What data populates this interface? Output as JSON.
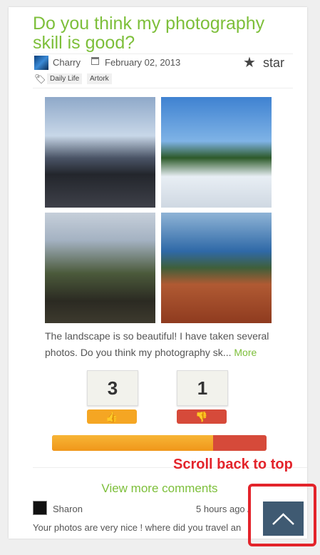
{
  "post": {
    "title": "Do you think my photography skill is good?",
    "author": "Charry",
    "date": "February 02, 2013",
    "rating_label": "star",
    "tags": [
      "Daily Life",
      "Artork"
    ],
    "excerpt": "The landscape is so beautiful! I have taken several photos. Do you think my photography sk...",
    "more_label": "More"
  },
  "votes": {
    "up": "3",
    "down": "1",
    "up_fraction": 0.75
  },
  "comments": {
    "view_more_label": "View more comments",
    "first": {
      "author": "Sharon",
      "time": "5 hours ago /",
      "text": "Your photos are very nice ! where did you travel an"
    }
  },
  "annotation": {
    "label": "Scroll back to top",
    "color": "#e3242b"
  },
  "colors": {
    "accent": "#7dbf3a",
    "up": "#f5a623",
    "down": "#d64a3a",
    "scroll_button": "#3f5a72"
  }
}
